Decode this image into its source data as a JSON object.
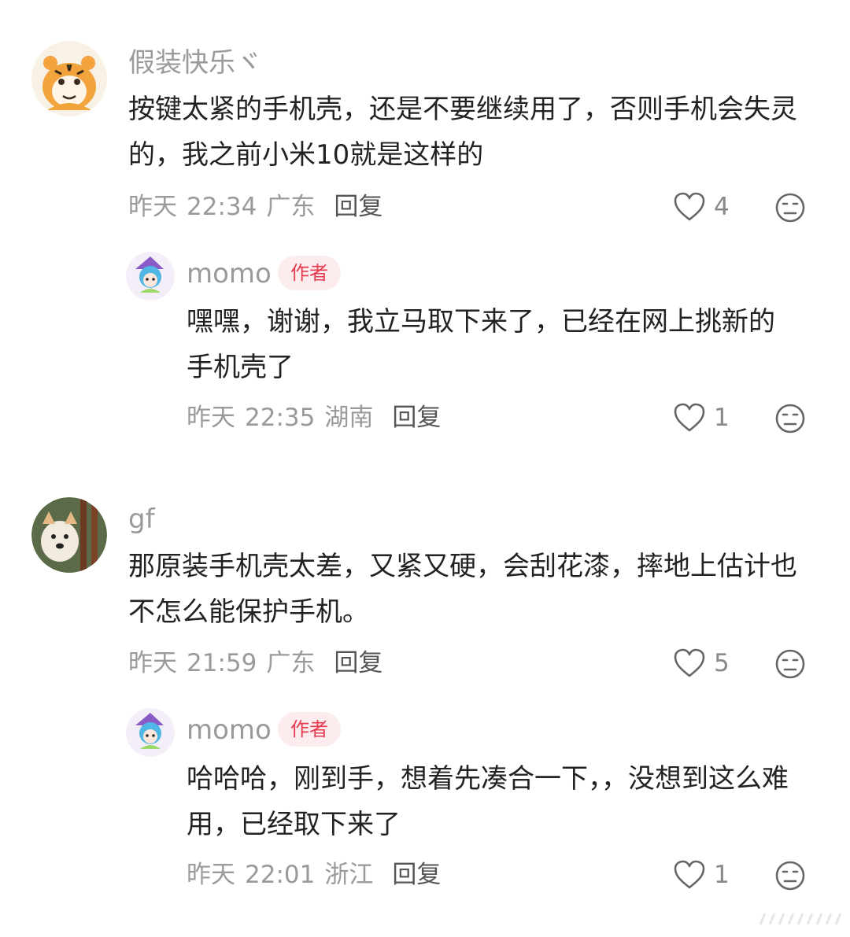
{
  "comments": [
    {
      "username": "假装快乐ヾ",
      "text": "按键太紧的手机壳，还是不要继续用了，否则手机会失灵的，我之前小米10就是这样的",
      "date": "昨天",
      "time": "22:34",
      "location": "广东",
      "reply_label": "回复",
      "likes": "4",
      "reply": {
        "username": "momo",
        "badge": "作者",
        "text": "嘿嘿，谢谢，我立马取下来了，已经在网上挑新的手机壳了",
        "date": "昨天",
        "time": "22:35",
        "location": "湖南",
        "reply_label": "回复",
        "likes": "1"
      }
    },
    {
      "username": "gf",
      "text": "那原装手机壳太差，又紧又硬，会刮花漆，摔地上估计也不怎么能保护手机。",
      "date": "昨天",
      "time": "21:59",
      "location": "广东",
      "reply_label": "回复",
      "likes": "5",
      "reply": {
        "username": "momo",
        "badge": "作者",
        "text": "哈哈哈，刚到手，想着先凑合一下，，没想到这么难用，已经取下来了",
        "date": "昨天",
        "time": "22:01",
        "location": "浙江",
        "reply_label": "回复",
        "likes": "1"
      }
    }
  ],
  "icons": {
    "like": "heart-outline-icon",
    "dislike": "neutral-face-icon"
  },
  "colors": {
    "author_badge_bg": "#fdecee",
    "author_badge_text": "#e53a4f",
    "meta_text": "#9a9a9a",
    "body_text": "#222222"
  }
}
